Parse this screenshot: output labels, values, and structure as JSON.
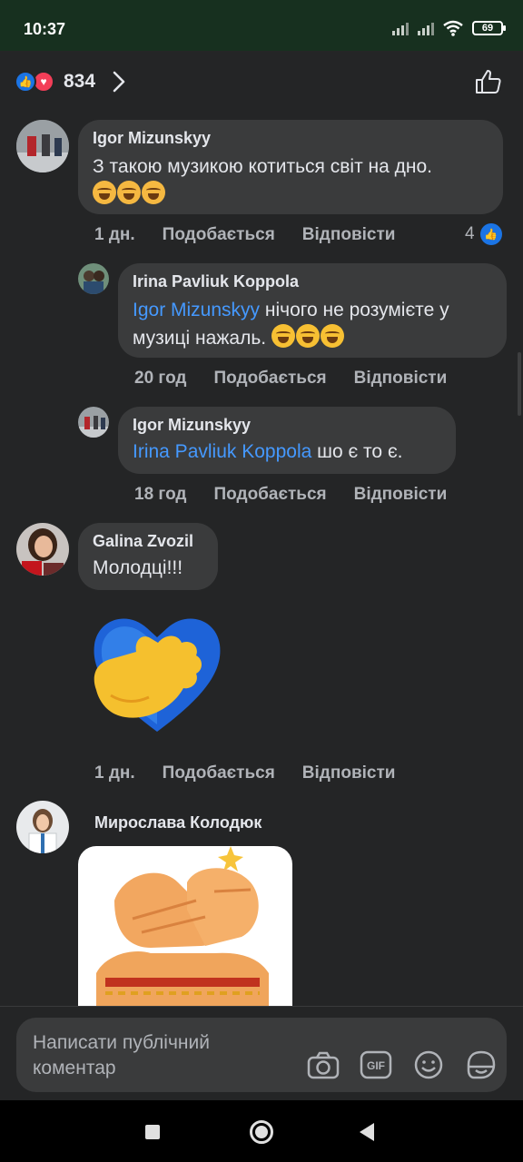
{
  "status_bar": {
    "time": "10:37",
    "battery": "69"
  },
  "reactions": {
    "count": "834"
  },
  "comments": [
    {
      "author": "Igor Mizunskyy",
      "text": "З такою музикою котиться світ на дно.",
      "time": "1 дн.",
      "like_label": "Подобається",
      "reply_label": "Відповісти",
      "like_count": "4"
    },
    {
      "author": "Irina Pavliuk Koppola",
      "mention": "Igor Mizunskyy",
      "text": " нічого не розумієте у музиці нажаль.",
      "time": "20 год",
      "like_label": "Подобається",
      "reply_label": "Відповісти"
    },
    {
      "author": "Igor Mizunskyy",
      "mention": "Irina Pavliuk Koppola",
      "text": " шо є то є.",
      "time": "18 год",
      "like_label": "Подобається",
      "reply_label": "Відповісти"
    },
    {
      "author": "Galina Zvozil",
      "text": "Молодці!!!",
      "time": "1 дн.",
      "like_label": "Подобається",
      "reply_label": "Відповісти"
    },
    {
      "author": "Мирослава Колодюк"
    }
  ],
  "composer": {
    "placeholder": "Написати публічний коментар"
  },
  "colors": {
    "accent": "#1b74e4",
    "mention": "#4599ff",
    "bubble": "#3a3b3c",
    "background": "#242526"
  }
}
